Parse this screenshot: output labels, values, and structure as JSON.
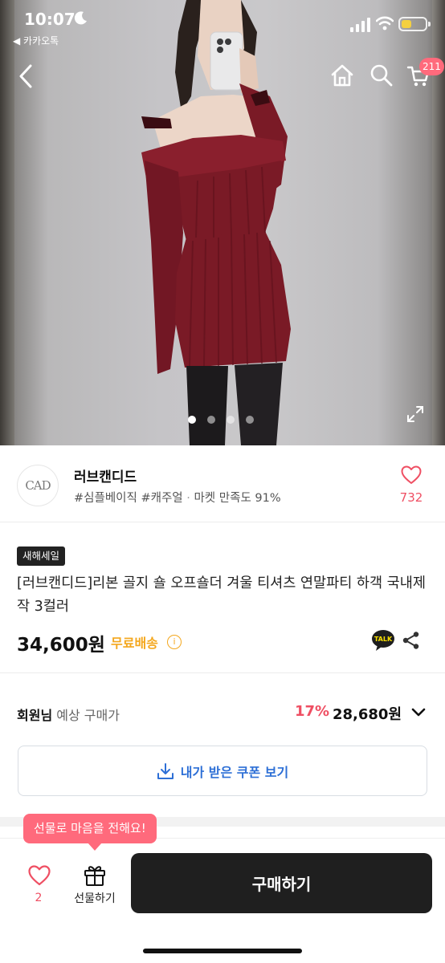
{
  "status_bar": {
    "time": "10:07",
    "back_app": "◀ 카카오톡"
  },
  "header": {
    "cart_count": "211"
  },
  "gallery": {
    "image_count": 4,
    "active_index": 0
  },
  "shop": {
    "logo_text": "CAD",
    "name": "러브캔디드",
    "tags": "#심플베이직 #캐주얼",
    "separator": " · ",
    "satisfaction": "마켓 만족도 91%",
    "like_count": "732"
  },
  "product": {
    "sale_badge": "새해세일",
    "title": "[러브캔디드]리본 골지 숄 오프숄더 겨울 티셔츠 연말파티 하객 국내제작 3컬러",
    "price": "34,600원",
    "shipping": "무료배송",
    "info_symbol": "i",
    "talk_label": "TALK"
  },
  "member": {
    "label_bold": "회원님",
    "label_rest": " 예상 구매가",
    "discount": "17%",
    "price": "28,680원"
  },
  "coupon": {
    "label": "내가 받은 쿠폰 보기"
  },
  "bottom_bar": {
    "tooltip": "선물로 마음을 전해요!",
    "like_count": "2",
    "gift_label": "선물하기",
    "buy_label": "구매하기"
  },
  "colors": {
    "accent_pink": "#ef4f63",
    "badge_pink": "#ff6a7c",
    "shipping_orange": "#f4a71d",
    "coupon_blue": "#2d6fd6",
    "buy_button": "#1f1f1f",
    "dress_red": "#7a1a26"
  },
  "icons": [
    "chevron-left-icon",
    "home-icon",
    "search-icon",
    "cart-icon",
    "expand-icon",
    "heart-icon",
    "info-icon",
    "kakao-talk-icon",
    "share-icon",
    "chevron-down-icon",
    "download-icon",
    "gift-icon",
    "moon-icon",
    "signal-icon",
    "wifi-icon",
    "battery-icon"
  ]
}
